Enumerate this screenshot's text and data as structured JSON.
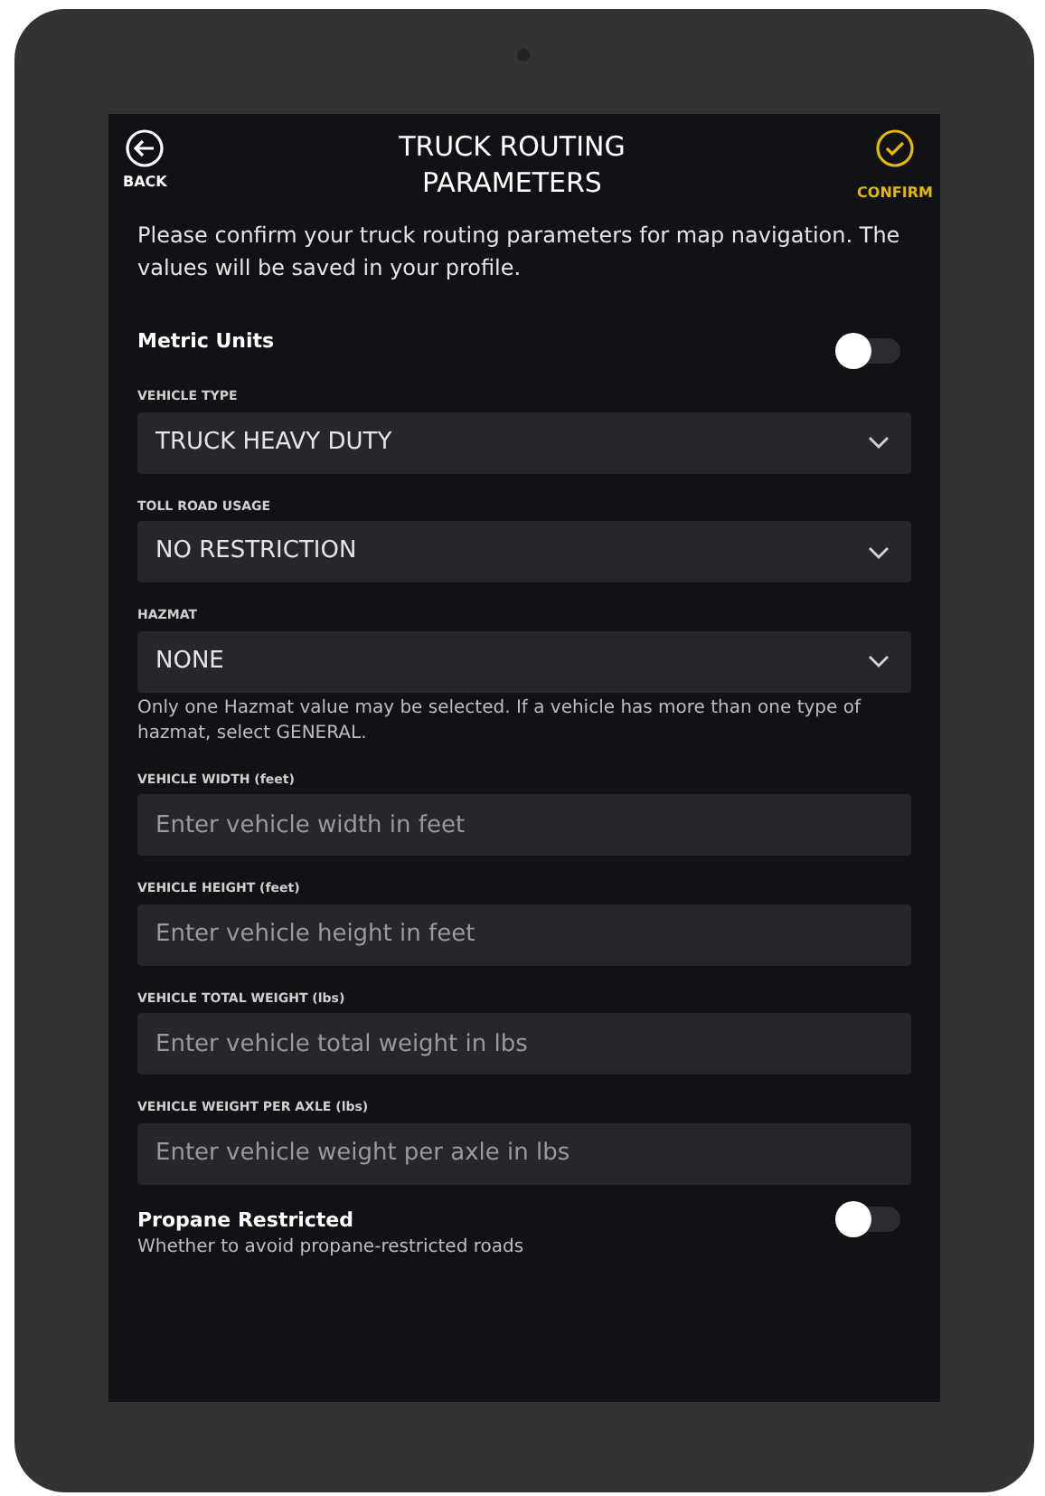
{
  "header": {
    "back_label": "BACK",
    "title": "TRUCK ROUTING PARAMETERS",
    "confirm_label": "CONFIRM"
  },
  "intro": "Please confirm your truck routing parameters for map navigation. The values will be saved in your profile.",
  "settings": [
    {
      "kind": "toggle",
      "label": "Metric Units",
      "on": false
    },
    {
      "kind": "select",
      "label": "VEHICLE TYPE",
      "value": "TRUCK HEAVY DUTY"
    },
    {
      "kind": "select",
      "label": "TOLL ROAD USAGE",
      "value": "NO RESTRICTION"
    },
    {
      "kind": "select",
      "label": "HAZMAT",
      "value": "NONE",
      "help": "Only one Hazmat value may be selected. If a vehicle has more than one type of hazmat, select GENERAL."
    },
    {
      "kind": "input",
      "label": "VEHICLE WIDTH (feet)",
      "placeholder": "Enter vehicle width in feet"
    },
    {
      "kind": "input",
      "label": "VEHICLE HEIGHT (feet)",
      "placeholder": "Enter vehicle height in feet"
    },
    {
      "kind": "input",
      "label": "VEHICLE TOTAL WEIGHT (lbs)",
      "placeholder": "Enter vehicle total weight in lbs"
    },
    {
      "kind": "input",
      "label": "VEHICLE WEIGHT PER AXLE (lbs)",
      "placeholder": "Enter vehicle weight per axle in lbs"
    },
    {
      "kind": "toggle",
      "label": "Propane Restricted",
      "help": "Whether to avoid propane-restricted roads",
      "on": false
    }
  ]
}
